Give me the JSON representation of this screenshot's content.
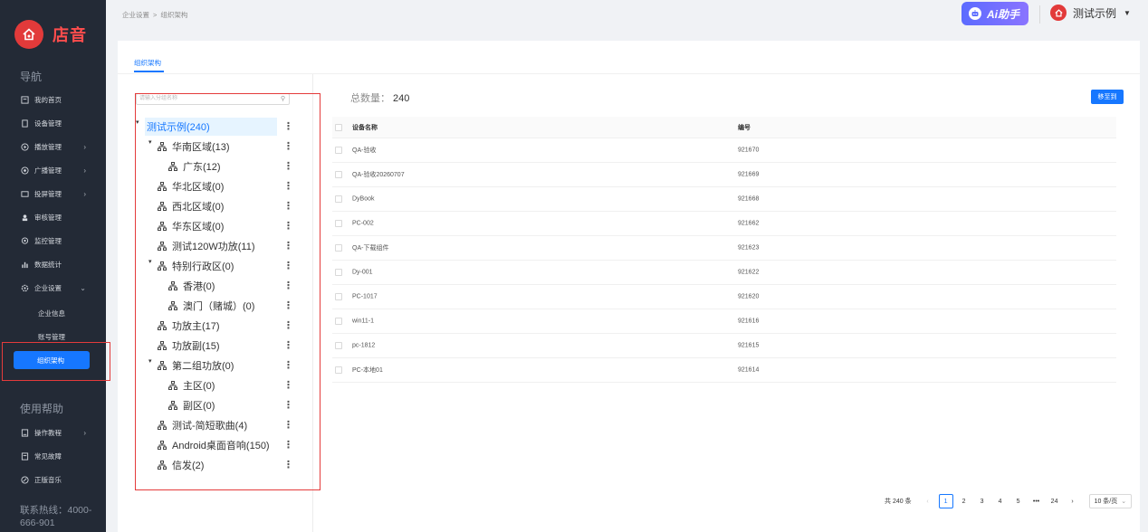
{
  "brand": {
    "name": "店音",
    "accent": "#e23a3a"
  },
  "nav": {
    "section_title": "导航",
    "items": [
      {
        "label": "我的首页",
        "icon": "home-icon"
      },
      {
        "label": "设备管理",
        "icon": "device-icon"
      },
      {
        "label": "播放管理",
        "icon": "play-icon",
        "arrow": "›"
      },
      {
        "label": "广播管理",
        "icon": "broadcast-icon",
        "arrow": "›"
      },
      {
        "label": "投屏管理",
        "icon": "screen-icon",
        "arrow": "›"
      },
      {
        "label": "审核管理",
        "icon": "audit-icon"
      },
      {
        "label": "监控管理",
        "icon": "monitor-icon"
      },
      {
        "label": "数据统计",
        "icon": "chart-icon"
      },
      {
        "label": "企业设置",
        "icon": "gear-icon",
        "arrow": "⌄"
      }
    ],
    "sub_items": [
      "企业信息",
      "账号管理"
    ],
    "active_item": "组织架构",
    "help_title": "使用帮助",
    "help_items": [
      {
        "label": "操作教程",
        "icon": "tutorial-icon",
        "arrow": "›"
      },
      {
        "label": "常见故障",
        "icon": "fault-icon"
      },
      {
        "label": "正版音乐",
        "icon": "music-icon"
      }
    ],
    "hotline": "联系热线：4000-666-901"
  },
  "header": {
    "breadcrumb": [
      "企业设置",
      "组织架构"
    ],
    "breadcrumb_sep": ">",
    "ai_label": "Ai助手",
    "user_name": "测试示例"
  },
  "main": {
    "tab": "组织架构",
    "search_placeholder": "请输入分组名称",
    "tree": [
      {
        "label": "测试示例(240)",
        "level": 0,
        "expanded": true,
        "selected": true
      },
      {
        "label": "华南区域(13)",
        "level": 1,
        "expanded": true
      },
      {
        "label": "广东(12)",
        "level": 2
      },
      {
        "label": "华北区域(0)",
        "level": 1
      },
      {
        "label": "西北区域(0)",
        "level": 1
      },
      {
        "label": "华东区域(0)",
        "level": 1
      },
      {
        "label": "测试120W功放(11)",
        "level": 1
      },
      {
        "label": "特别行政区(0)",
        "level": 1,
        "expanded": true
      },
      {
        "label": "香港(0)",
        "level": 2
      },
      {
        "label": "澳门（赌城）(0)",
        "level": 2
      },
      {
        "label": "功放主(17)",
        "level": 1
      },
      {
        "label": "功放副(15)",
        "level": 1
      },
      {
        "label": "第二组功放(0)",
        "level": 1,
        "expanded": true
      },
      {
        "label": "主区(0)",
        "level": 2
      },
      {
        "label": "副区(0)",
        "level": 2
      },
      {
        "label": "测试-简短歌曲(4)",
        "level": 1
      },
      {
        "label": "Android桌面音响(150)",
        "level": 1
      },
      {
        "label": "信发(2)",
        "level": 1
      }
    ],
    "total_label": "总数量：",
    "total_value": "240",
    "move_button": "移至到",
    "table": {
      "columns": [
        "设备名称",
        "编号"
      ],
      "rows": [
        [
          "QA-验收",
          "921670"
        ],
        [
          "QA-验收20260707",
          "921669"
        ],
        [
          "DyBook",
          "921668"
        ],
        [
          "PC-002",
          "921662"
        ],
        [
          "QA-下载组件",
          "921623"
        ],
        [
          "Dy-001",
          "921622"
        ],
        [
          "PC-1017",
          "921620"
        ],
        [
          "win11-1",
          "921616"
        ],
        [
          "pc-1812",
          "921615"
        ],
        [
          "PC-本地01",
          "921614"
        ]
      ]
    },
    "pagination": {
      "total_text": "共 240 条",
      "prev": "‹",
      "next": "›",
      "pages": [
        "1",
        "2",
        "3",
        "4",
        "5",
        "•••",
        "24"
      ],
      "current": "1",
      "page_size": "10 条/页"
    }
  },
  "colors": {
    "primary": "#1677ff",
    "sidebar_bg": "#232a36",
    "highlight_box": "#e43b3b"
  }
}
